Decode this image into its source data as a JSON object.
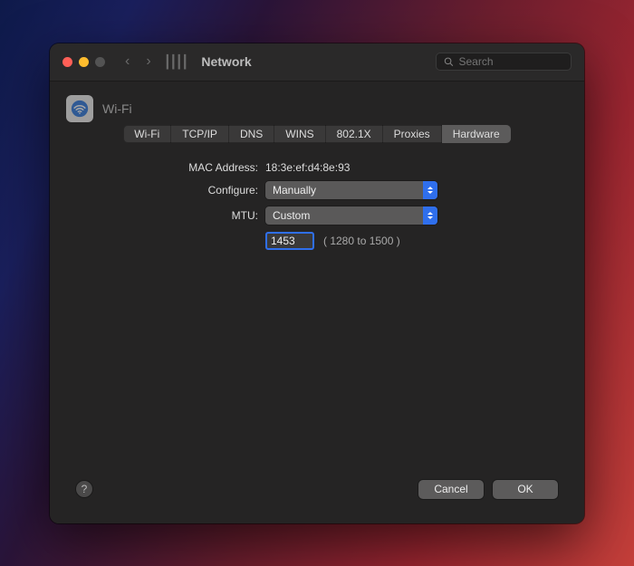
{
  "window": {
    "title": "Network",
    "search_placeholder": "Search"
  },
  "header": {
    "service_name": "Wi-Fi"
  },
  "tabs": [
    {
      "label": "Wi-Fi"
    },
    {
      "label": "TCP/IP"
    },
    {
      "label": "DNS"
    },
    {
      "label": "WINS"
    },
    {
      "label": "802.1X"
    },
    {
      "label": "Proxies"
    },
    {
      "label": "Hardware"
    }
  ],
  "form": {
    "mac_label": "MAC Address:",
    "mac_value": "18:3e:ef:d4:8e:93",
    "configure_label": "Configure:",
    "configure_value": "Manually",
    "mtu_label": "MTU:",
    "mtu_select_value": "Custom",
    "mtu_number": "1453",
    "mtu_hint": "( 1280 to 1500 )"
  },
  "buttons": {
    "cancel": "Cancel",
    "ok": "OK"
  },
  "help_glyph": "?"
}
